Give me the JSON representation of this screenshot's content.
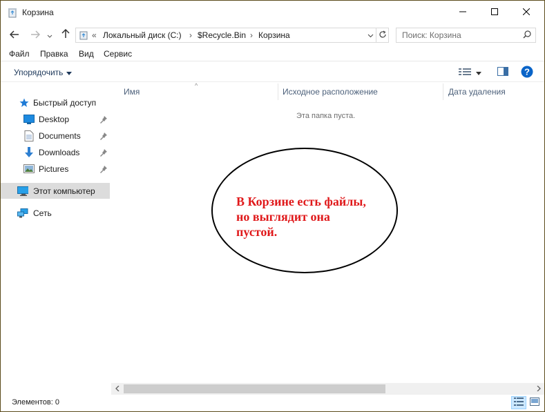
{
  "window": {
    "title": "Корзина",
    "icons": {
      "app": "recycle-bin-icon",
      "minimize": "minimize-icon",
      "maximize": "maximize-icon",
      "close": "close-icon"
    }
  },
  "address": {
    "overflow": "«",
    "crumbs": [
      "Локальный диск (C:)",
      "$Recycle.Bin",
      "Корзина"
    ],
    "separator": "›"
  },
  "search": {
    "placeholder": "Поиск: Корзина"
  },
  "menu": {
    "items": [
      "Файл",
      "Правка",
      "Вид",
      "Сервис"
    ]
  },
  "toolbar": {
    "organize_label": "Упорядочить"
  },
  "nav": {
    "quick_access": "Быстрый доступ",
    "items": [
      {
        "label": "Desktop",
        "icon": "desktop-folder-icon",
        "pinned": true
      },
      {
        "label": "Documents",
        "icon": "documents-folder-icon",
        "pinned": true
      },
      {
        "label": "Downloads",
        "icon": "downloads-folder-icon",
        "pinned": true
      },
      {
        "label": "Pictures",
        "icon": "pictures-folder-icon",
        "pinned": true
      }
    ],
    "this_pc": "Этот компьютер",
    "network": "Сеть"
  },
  "columns": {
    "name": "Имя",
    "original_location": "Исходное расположение",
    "date_deleted": "Дата удаления"
  },
  "content": {
    "empty_message": "Эта папка пуста."
  },
  "status": {
    "items": "Элементов: 0"
  },
  "annotation": {
    "lines": [
      "В Корзине есть файлы,",
      "но выглядит она",
      "пустой."
    ],
    "text_color": "#e0191b"
  },
  "colors": {
    "accent": "#0078d7",
    "selected_nav": "#dcdcdc",
    "column_header_text": "#4c607a"
  }
}
